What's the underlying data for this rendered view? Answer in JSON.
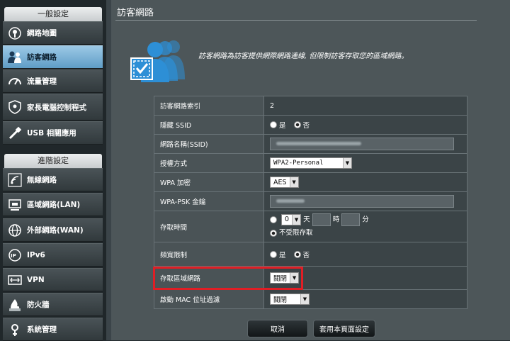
{
  "sidebar": {
    "general_header": "一般設定",
    "advanced_header": "進階設定",
    "general_items": [
      {
        "label": "網路地圖",
        "icon": "network-map-icon"
      },
      {
        "label": "訪客網路",
        "icon": "guest-network-icon",
        "active": true
      },
      {
        "label": "流量管理",
        "icon": "traffic-manager-icon"
      },
      {
        "label": "家長電腦控制程式",
        "icon": "parental-control-icon"
      },
      {
        "label": "USB 相關應用",
        "icon": "usb-icon"
      }
    ],
    "advanced_items": [
      {
        "label": "無線網路",
        "icon": "wireless-icon"
      },
      {
        "label": "區域網路(LAN)",
        "icon": "lan-icon"
      },
      {
        "label": "外部網路(WAN)",
        "icon": "wan-globe-icon"
      },
      {
        "label": "IPv6",
        "icon": "ipv6-icon"
      },
      {
        "label": "VPN",
        "icon": "vpn-icon"
      },
      {
        "label": "防火牆",
        "icon": "firewall-icon"
      },
      {
        "label": "系統管理",
        "icon": "administration-icon"
      }
    ]
  },
  "main": {
    "title": "訪客網路",
    "description": "訪客網路為訪客提供網際網路連線, 但限制訪客存取您的區域網路。"
  },
  "form": {
    "index_label": "訪客網路索引",
    "index_value": "2",
    "hide_ssid_label": "隱藏 SSID",
    "yes": "是",
    "no": "否",
    "ssid_label": "網路名稱(SSID)",
    "auth_label": "授權方式",
    "auth_value": "WPA2-Personal",
    "wpa_enc_label": "WPA 加密",
    "wpa_enc_value": "AES",
    "psk_label": "WPA-PSK 金鑰",
    "access_time_label": "存取時間",
    "day_value": "0",
    "day_unit": "天",
    "hour_unit": "時",
    "minute_unit": "分",
    "unlimited": "不受限存取",
    "bandwidth_label": "頻寬限制",
    "intranet_label": "存取區域網路",
    "intranet_value": "關閉",
    "mac_label": "啟動 MAC 位址過濾",
    "mac_value": "關閉"
  },
  "buttons": {
    "cancel": "取消",
    "apply": "套用本頁面設定"
  },
  "colors": {
    "highlight_box": "#e01e25",
    "active_nav": "#6aa7cf",
    "hero_blue": "#2d8fd6"
  }
}
